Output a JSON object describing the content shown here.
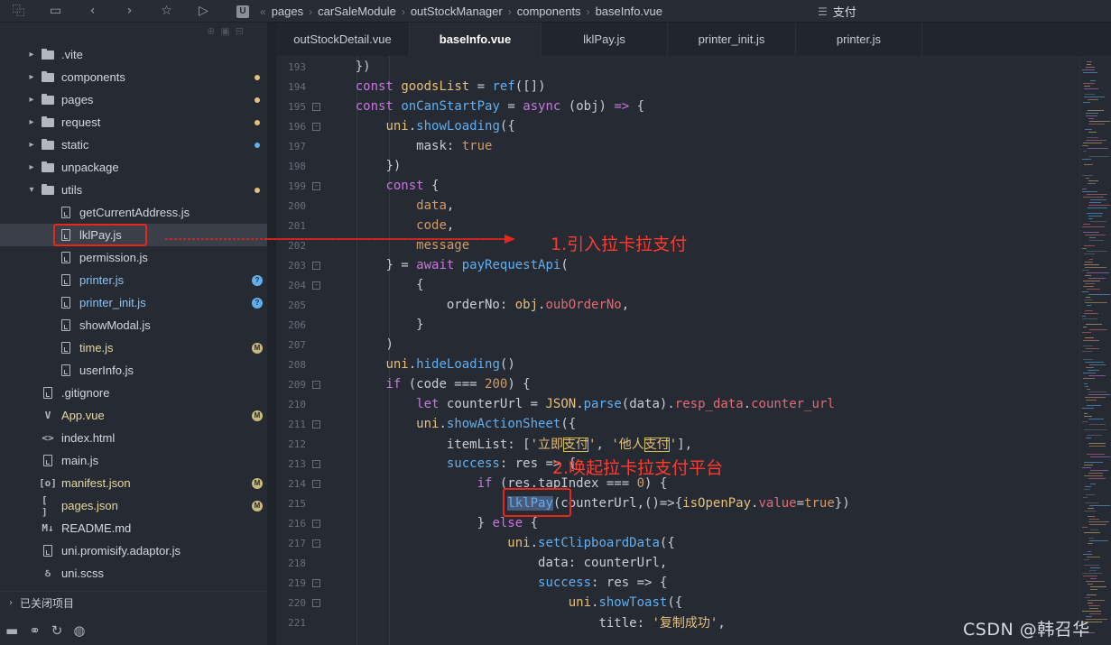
{
  "toolbar": {
    "icons": [
      "outline-icon",
      "save-icon",
      "back-icon",
      "forward-icon",
      "star-icon",
      "run-icon"
    ]
  },
  "breadcrumb": {
    "logo": "U",
    "items": [
      "pages",
      "carSaleModule",
      "outStockManager",
      "components",
      "baseInfo.vue"
    ]
  },
  "search": {
    "label": "支付"
  },
  "sidebar": {
    "items": [
      {
        "label": ".vite",
        "type": "folder",
        "depth": 1,
        "arrow": "▸"
      },
      {
        "label": "components",
        "type": "folder",
        "depth": 1,
        "arrow": "▸",
        "badge": "dot",
        "badge_color": "#e5c07b"
      },
      {
        "label": "pages",
        "type": "folder",
        "depth": 1,
        "arrow": "▸",
        "badge": "dot",
        "badge_color": "#e5c07b"
      },
      {
        "label": "request",
        "type": "folder",
        "depth": 1,
        "arrow": "▸",
        "badge": "dot",
        "badge_color": "#e5c07b"
      },
      {
        "label": "static",
        "type": "folder",
        "depth": 1,
        "arrow": "▸",
        "badge": "dot",
        "badge_color": "#61afef"
      },
      {
        "label": "unpackage",
        "type": "folder",
        "depth": 1,
        "arrow": "▸"
      },
      {
        "label": "utils",
        "type": "folder",
        "depth": 1,
        "arrow": "▾",
        "badge": "dot",
        "badge_color": "#e5c07b"
      },
      {
        "label": "getCurrentAddress.js",
        "type": "file",
        "depth": 2
      },
      {
        "label": "lklPay.js",
        "type": "file",
        "depth": 2,
        "selected": true
      },
      {
        "label": "permission.js",
        "type": "file",
        "depth": 2
      },
      {
        "label": "printer.js",
        "type": "file",
        "depth": 2,
        "badge": "?",
        "badge_color": "#61afef",
        "label_color": "#8fc3f5"
      },
      {
        "label": "printer_init.js",
        "type": "file",
        "depth": 2,
        "badge": "?",
        "badge_color": "#61afef",
        "label_color": "#8fc3f5"
      },
      {
        "label": "showModal.js",
        "type": "file",
        "depth": 2
      },
      {
        "label": "time.js",
        "type": "file",
        "depth": 2,
        "badge": "M",
        "badge_color": "#c8b97a",
        "label_color": "#e8d9a0"
      },
      {
        "label": "userInfo.js",
        "type": "file",
        "depth": 2
      },
      {
        "label": ".gitignore",
        "type": "file",
        "depth": 1
      },
      {
        "label": "App.vue",
        "type": "vue",
        "depth": 1,
        "badge": "M",
        "badge_color": "#c8b97a",
        "label_color": "#e8d9a0"
      },
      {
        "label": "index.html",
        "type": "html",
        "depth": 1
      },
      {
        "label": "main.js",
        "type": "file",
        "depth": 1
      },
      {
        "label": "manifest.json",
        "type": "json",
        "depth": 1,
        "badge": "M",
        "badge_color": "#c8b97a",
        "label_color": "#e8d9a0"
      },
      {
        "label": "pages.json",
        "type": "json2",
        "depth": 1,
        "badge": "M",
        "badge_color": "#c8b97a",
        "label_color": "#e8d9a0"
      },
      {
        "label": "README.md",
        "type": "md",
        "depth": 1
      },
      {
        "label": "uni.promisify.adaptor.js",
        "type": "file",
        "depth": 1
      },
      {
        "label": "uni.scss",
        "type": "scss",
        "depth": 1
      }
    ],
    "closed_projects": "已关闭项目",
    "bottom_icons": [
      "folder-icon",
      "binoculars-icon",
      "sync-icon",
      "globe-icon"
    ]
  },
  "tabs": [
    {
      "label": "outStockDetail.vue",
      "active": false
    },
    {
      "label": "baseInfo.vue",
      "active": true
    },
    {
      "label": "lklPay.js",
      "active": false
    },
    {
      "label": "printer_init.js",
      "active": false
    },
    {
      "label": "printer.js",
      "active": false
    }
  ],
  "code": [
    {
      "n": "193",
      "fold": false,
      "html": "    <span class='pl'>})</span>"
    },
    {
      "n": "194",
      "fold": false,
      "html": "    <span class='kw'>const</span> <span class='prop'>goodsList</span> <span class='pl'>=</span> <span class='fn'>ref</span><span class='pl'>([])</span>"
    },
    {
      "n": "195",
      "fold": true,
      "html": "    <span class='kw'>const</span> <span class='fn'>onCanStartPay</span> <span class='pl'>=</span> <span class='kw'>async</span> <span class='pl'>(obj) </span><span class='kw'>=&gt;</span> <span class='pl'>{</span>"
    },
    {
      "n": "196",
      "fold": true,
      "html": "        <span class='prop'>uni</span><span class='pl'>.</span><span class='fn'>showLoading</span><span class='pl'>({</span>"
    },
    {
      "n": "197",
      "fold": false,
      "html": "            <span class='pl'>mask: </span><span class='num'>true</span>"
    },
    {
      "n": "198",
      "fold": false,
      "html": "        <span class='pl'>})</span>"
    },
    {
      "n": "199",
      "fold": true,
      "html": "        <span class='kw'>const</span> <span class='pl'>{</span>"
    },
    {
      "n": "200",
      "fold": false,
      "html": "            <span class='num'>data</span><span class='pl'>,</span>"
    },
    {
      "n": "201",
      "fold": false,
      "html": "            <span class='num'>code</span><span class='pl'>,</span>"
    },
    {
      "n": "202",
      "fold": false,
      "html": "            <span class='num'>message</span>"
    },
    {
      "n": "203",
      "fold": true,
      "html": "        <span class='pl'>} = </span><span class='kw'>await</span> <span class='fn'>payRequestApi</span><span class='pl'>(</span>"
    },
    {
      "n": "204",
      "fold": true,
      "html": "            <span class='pl'>{</span>"
    },
    {
      "n": "205",
      "fold": false,
      "html": "                <span class='pl'>orderNo: </span><span class='prop'>obj</span><span class='pl'>.</span><span class='str'>oubOrderNo</span><span class='pl'>,</span>"
    },
    {
      "n": "206",
      "fold": false,
      "html": "            <span class='pl'>}</span>"
    },
    {
      "n": "207",
      "fold": false,
      "html": "        <span class='pl'>)</span>"
    },
    {
      "n": "208",
      "fold": false,
      "html": "        <span class='prop'>uni</span><span class='pl'>.</span><span class='fn'>hideLoading</span><span class='pl'>()</span>"
    },
    {
      "n": "209",
      "fold": true,
      "html": "        <span class='kw'>if</span> <span class='pl'>(code === </span><span class='num'>200</span><span class='pl'>) {</span>"
    },
    {
      "n": "210",
      "fold": false,
      "html": "            <span class='kw'>let</span> <span class='pl'>counterUrl = </span><span class='prop'>JSON</span><span class='pl'>.</span><span class='fn'>parse</span><span class='pl'>(data).</span><span class='str'>resp_data</span><span class='pl'>.</span><span class='str'>counter_url</span>"
    },
    {
      "n": "211",
      "fold": true,
      "html": "            <span class='prop'>uni</span><span class='pl'>.</span><span class='fn'>showActionSheet</span><span class='pl'>({</span>"
    },
    {
      "n": "212",
      "fold": false,
      "html": "                <span class='pl'>itemList: [</span><span class='prop'>'立即<span class=\"hl-yellow\">支付</span>'</span><span class='pl'>, </span><span class='prop'>'他人<span class=\"hl-yellow\">支付</span>'</span><span class='pl'>],</span>"
    },
    {
      "n": "213",
      "fold": true,
      "html": "                <span class='fn'>success</span><span class='pl'>: res =&gt; {</span>"
    },
    {
      "n": "214",
      "fold": true,
      "html": "                    <span class='kw'>if</span> <span class='pl'>(res.tapIndex === </span><span class='num'>0</span><span class='pl'>) {</span>"
    },
    {
      "n": "215",
      "fold": false,
      "html": "                        <span class='fn hl-sel'>lklPay</span><span class='pl'>(counterUrl,()=&gt;{</span><span class='prop'>isOpenPay</span><span class='pl'>.</span><span class='str'>value</span><span class='pl'>=</span><span class='num'>true</span><span class='pl'>})</span>"
    },
    {
      "n": "216",
      "fold": true,
      "html": "                    <span class='pl'>} </span><span class='kw'>else</span> <span class='pl'>{</span>"
    },
    {
      "n": "217",
      "fold": true,
      "html": "                        <span class='prop'>uni</span><span class='pl'>.</span><span class='fn'>setClipboardData</span><span class='pl'>({</span>"
    },
    {
      "n": "218",
      "fold": false,
      "html": "                            <span class='pl'>data: counterUrl,</span>"
    },
    {
      "n": "219",
      "fold": true,
      "html": "                            <span class='fn'>success</span><span class='pl'>: res =&gt; {</span>"
    },
    {
      "n": "220",
      "fold": true,
      "html": "                                <span class='prop'>uni</span><span class='pl'>.</span><span class='fn'>showToast</span><span class='pl'>({</span>"
    },
    {
      "n": "221",
      "fold": false,
      "html": "                                    <span class='pl'>title: </span><span class='prop'>'复制成功'</span><span class='pl'>,</span>"
    }
  ],
  "annotations": {
    "step1": "1.引入拉卡拉支付",
    "step2": "2.唤起拉卡拉支付平台",
    "arrow_color": "#e8261c"
  },
  "watermark": "CSDN @韩召华"
}
